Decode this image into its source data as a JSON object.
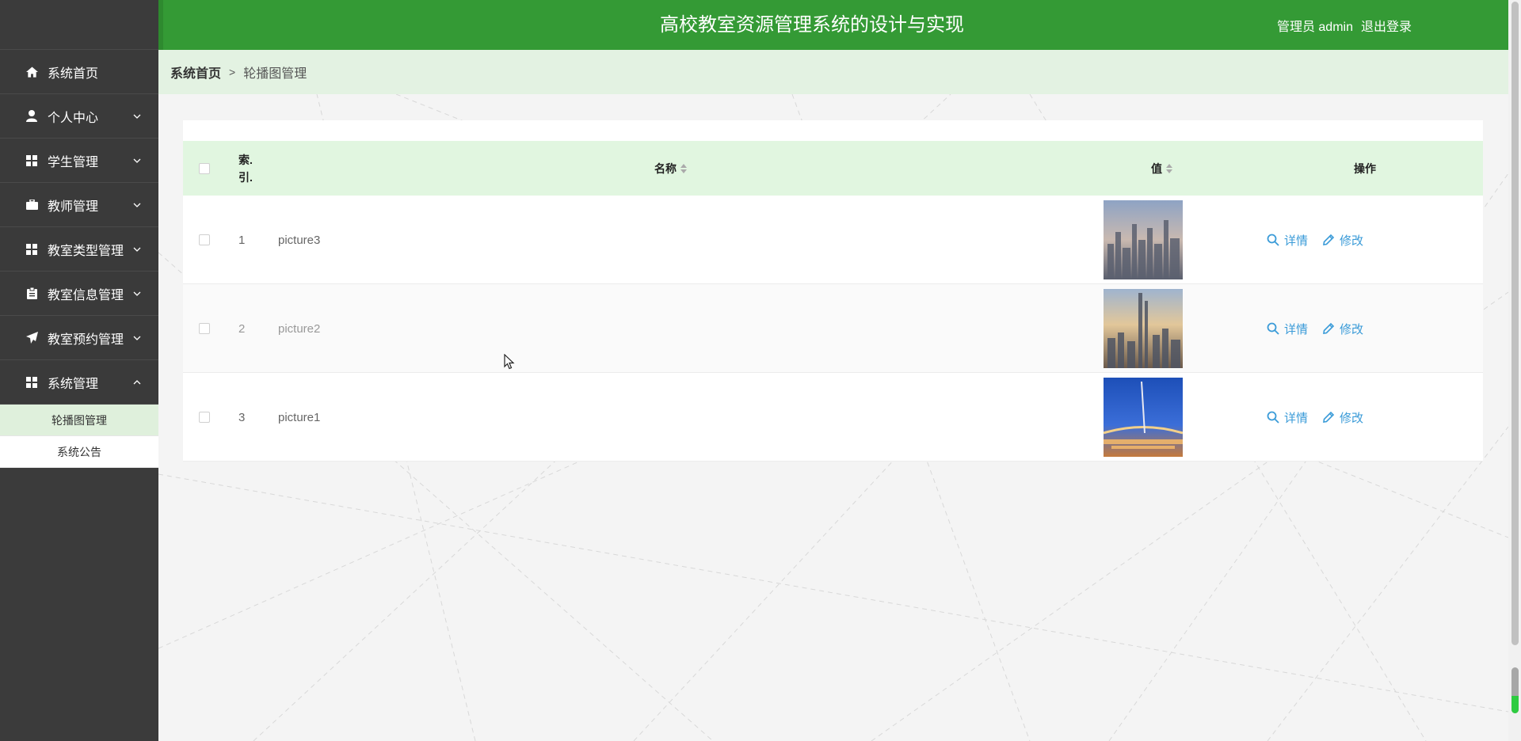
{
  "header": {
    "title": "高校教室资源管理系统的设计与实现",
    "role_user": "管理员 admin",
    "logout": "退出登录"
  },
  "sidebar": {
    "items": [
      {
        "label": "系统首页",
        "icon": "home-icon",
        "has_chevron": false
      },
      {
        "label": "个人中心",
        "icon": "user-icon",
        "has_chevron": true
      },
      {
        "label": "学生管理",
        "icon": "grid-icon",
        "has_chevron": true
      },
      {
        "label": "教师管理",
        "icon": "briefcase-icon",
        "has_chevron": true
      },
      {
        "label": "教室类型管理",
        "icon": "grid-icon",
        "has_chevron": true
      },
      {
        "label": "教室信息管理",
        "icon": "clipboard-icon",
        "has_chevron": true
      },
      {
        "label": "教室预约管理",
        "icon": "send-icon",
        "has_chevron": true
      },
      {
        "label": "系统管理",
        "icon": "grid-icon",
        "has_chevron": true,
        "expanded": true
      }
    ],
    "subitems": [
      {
        "label": "轮播图管理",
        "active": true
      },
      {
        "label": "系统公告",
        "active": false
      }
    ]
  },
  "breadcrumb": {
    "home": "系统首页",
    "separator": ">",
    "current": "轮播图管理"
  },
  "table": {
    "headers": {
      "index": "索.\n引.",
      "name": "名称",
      "value": "值",
      "actions": "操作"
    },
    "rows": [
      {
        "index": "1",
        "name": "picture3",
        "image": "city skyline at dusk"
      },
      {
        "index": "2",
        "name": "picture2",
        "image": "skyscrapers at sunset"
      },
      {
        "index": "3",
        "name": "picture1",
        "image": "illuminated bridge at night"
      }
    ],
    "detail_label": "详情",
    "edit_label": "修改"
  },
  "colors": {
    "header_green": "#349a35",
    "sidebar_dark": "#3b3b3b",
    "breadcrumb_bg": "#e3f2e2",
    "thead_bg": "#e1f6e0",
    "action_blue": "#3a9bd8"
  }
}
